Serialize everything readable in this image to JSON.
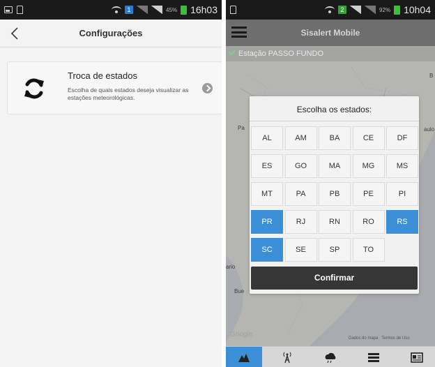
{
  "left_screen": {
    "status_bar": {
      "time": "16h03",
      "battery_percent": "45%",
      "sim_number": "1"
    },
    "header": {
      "title": "Configurações",
      "back_icon": "arrow-left-icon"
    },
    "settings_item": {
      "title": "Troca de estados",
      "description": "Escolha de quais estados deseja visualizar as estações meteorológicas.",
      "icon": "sync-icon",
      "chevron_icon": "chevron-right-icon"
    }
  },
  "right_screen": {
    "status_bar": {
      "time": "10h04",
      "battery_percent": "92%",
      "sim_number": "2"
    },
    "header": {
      "title": "Sisalert Mobile",
      "menu_icon": "hamburger-menu-icon"
    },
    "map": {
      "station_label": "Estação PASSO FUNDO",
      "labels": [
        "Pa",
        "aulo",
        "B",
        "ario",
        "Bue"
      ],
      "attribution": "Dados do mapa   Termos de Uso",
      "google": "Google"
    },
    "dialog": {
      "title": "Escolha os estados:",
      "states": [
        {
          "code": "AL",
          "selected": false
        },
        {
          "code": "AM",
          "selected": false
        },
        {
          "code": "BA",
          "selected": false
        },
        {
          "code": "CE",
          "selected": false
        },
        {
          "code": "DF",
          "selected": false
        },
        {
          "code": "ES",
          "selected": false
        },
        {
          "code": "GO",
          "selected": false
        },
        {
          "code": "MA",
          "selected": false
        },
        {
          "code": "MG",
          "selected": false
        },
        {
          "code": "MS",
          "selected": false
        },
        {
          "code": "MT",
          "selected": false
        },
        {
          "code": "PA",
          "selected": false
        },
        {
          "code": "PB",
          "selected": false
        },
        {
          "code": "PE",
          "selected": false
        },
        {
          "code": "PI",
          "selected": false
        },
        {
          "code": "PR",
          "selected": true
        },
        {
          "code": "RJ",
          "selected": false
        },
        {
          "code": "RN",
          "selected": false
        },
        {
          "code": "RO",
          "selected": false
        },
        {
          "code": "RS",
          "selected": true
        },
        {
          "code": "SC",
          "selected": true
        },
        {
          "code": "SE",
          "selected": false
        },
        {
          "code": "SP",
          "selected": false
        },
        {
          "code": "TO",
          "selected": false
        }
      ],
      "confirm_label": "Confirmar"
    },
    "bottom_nav": [
      {
        "icon": "map-icon",
        "active": true
      },
      {
        "icon": "antenna-station-icon",
        "active": false
      },
      {
        "icon": "weather-cloud-icon",
        "active": false
      },
      {
        "icon": "list-icon",
        "active": false
      },
      {
        "icon": "news-icon",
        "active": false
      }
    ]
  },
  "colors": {
    "accent_blue": "#3b8fd6",
    "status_bar_bg": "#1a1a1a",
    "confirm_bg": "#363636"
  }
}
